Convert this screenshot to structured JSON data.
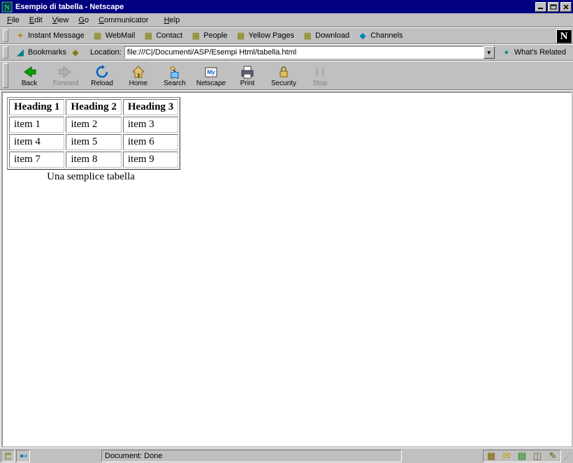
{
  "title": "Esempio di tabella - Netscape",
  "nlogo": "N",
  "menu": {
    "file": "File",
    "edit": "Edit",
    "view": "View",
    "go": "Go",
    "communicator": "Communicator",
    "help": "Help"
  },
  "personal": {
    "instant": "Instant Message",
    "webmail": "WebMail",
    "contact": "Contact",
    "people": "People",
    "yellow": "Yellow Pages",
    "download": "Download",
    "channels": "Channels"
  },
  "location": {
    "bookmarks": "Bookmarks",
    "label": "Location:",
    "url": "file:///C|/Documenti/ASP/Esempi Html/tabella.html",
    "related": "What's Related"
  },
  "nav": {
    "back": "Back",
    "forward": "Forward",
    "reload": "Reload",
    "home": "Home",
    "search": "Search",
    "netscape": "Netscape",
    "print": "Print",
    "security": "Security",
    "stop": "Stop"
  },
  "page": {
    "headers": [
      "Heading 1",
      "Heading 2",
      "Heading 3"
    ],
    "rows": [
      [
        "item 1",
        "item 2",
        "item 3"
      ],
      [
        "item 4",
        "item 5",
        "item 6"
      ],
      [
        "item 7",
        "item 8",
        "item 9"
      ]
    ],
    "caption": "Una semplice tabella"
  },
  "status": {
    "document": "Document: Done"
  }
}
